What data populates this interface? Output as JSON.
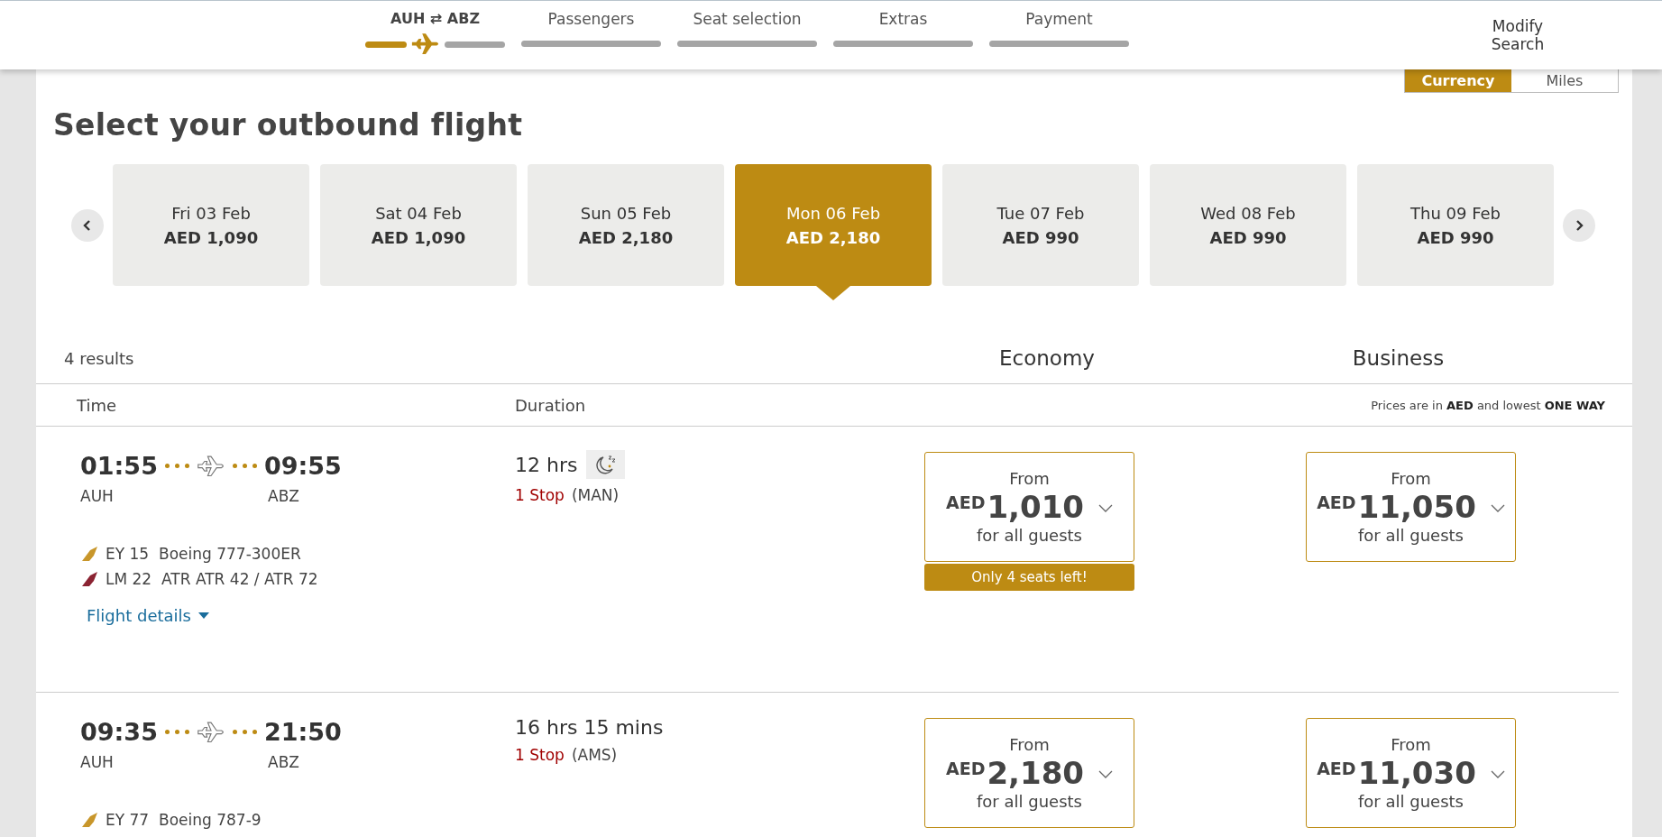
{
  "steps": [
    {
      "label": "AUH ⇄ ABZ",
      "selected": true
    },
    {
      "label": "Passengers",
      "selected": false
    },
    {
      "label": "Seat selection",
      "selected": false
    },
    {
      "label": "Extras",
      "selected": false
    },
    {
      "label": "Payment",
      "selected": false
    }
  ],
  "modify_search": "Modify Search",
  "price_toggle": [
    {
      "label": "Currency",
      "selected": true
    },
    {
      "label": "Miles",
      "selected": false
    }
  ],
  "title": "Select your outbound flight",
  "dates": [
    {
      "day": "Fri 03 Feb",
      "price": "AED 1,090",
      "selected": false
    },
    {
      "day": "Sat 04 Feb",
      "price": "AED 1,090",
      "selected": false
    },
    {
      "day": "Sun 05 Feb",
      "price": "AED 2,180",
      "selected": false
    },
    {
      "day": "Mon 06 Feb",
      "price": "AED 2,180",
      "selected": true
    },
    {
      "day": "Tue 07 Feb",
      "price": "AED 990",
      "selected": false
    },
    {
      "day": "Wed 08 Feb",
      "price": "AED 990",
      "selected": false
    },
    {
      "day": "Thu 09 Feb",
      "price": "AED 990",
      "selected": false
    }
  ],
  "results_count": "4 results",
  "cabins": [
    "Economy",
    "Business"
  ],
  "columns": [
    "Time",
    "Duration"
  ],
  "price_note": "Prices are in **AED** and lowest **ONE WAY**",
  "flights": [
    {
      "departure": "01:55",
      "origin": "AUH",
      "arrival": "09:55",
      "destination": "ABZ",
      "duration": "12 hrs",
      "overnight": true,
      "stops": "1 Stop",
      "via": "(MAN)",
      "legs": [
        {
          "flight": "EY 15",
          "aircraft": "Boeing 777-300ER",
          "color": "#c8962a"
        },
        {
          "flight": "LM 22",
          "aircraft": "ATR ATR 42 / ATR 72",
          "color": "#8b2332"
        }
      ],
      "details_link": "Flight details",
      "fares": [
        {
          "label": "From",
          "currency": "AED",
          "amount": "1,010",
          "note": "for all guests",
          "badge": "Only 4 seats left!"
        },
        {
          "label": "From",
          "currency": "AED",
          "amount": "11,050",
          "note": "for all guests"
        }
      ]
    },
    {
      "departure": "09:35",
      "origin": "AUH",
      "arrival": "21:50",
      "destination": "ABZ",
      "duration": "16 hrs 15 mins",
      "overnight": false,
      "stops": "1 Stop",
      "via": "(AMS)",
      "legs": [
        {
          "flight": "EY 77",
          "aircraft": "Boeing 787-9",
          "color": "#c8962a"
        }
      ],
      "fares": [
        {
          "label": "From",
          "currency": "AED",
          "amount": "2,180",
          "note": "for all guests"
        },
        {
          "label": "From",
          "currency": "AED",
          "amount": "11,030",
          "note": "for all guests"
        }
      ]
    }
  ]
}
